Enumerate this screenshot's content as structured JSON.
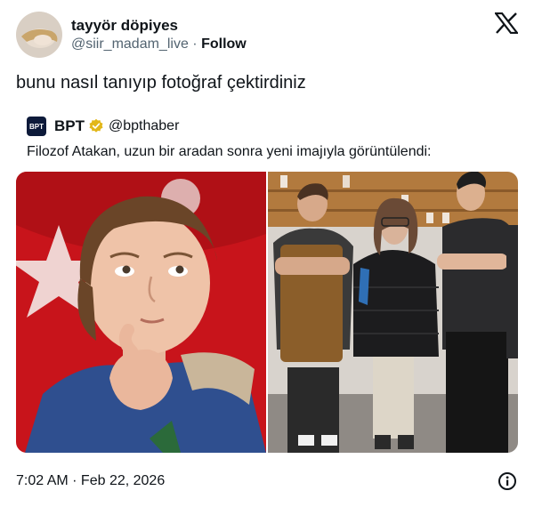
{
  "author": {
    "display_name": "tayyör döpiyes",
    "handle": "@siir_madam_live",
    "separator": "·",
    "follow_label": "Follow"
  },
  "tweet": {
    "text": "bunu nasıl tanıyıp fotoğraf çektirdiniz",
    "timestamp": "7:02 AM · Feb 22, 2026"
  },
  "quoted": {
    "avatar_text": "BPT",
    "name": "BPT",
    "handle": "@bpthaber",
    "text": "Filozof Atakan, uzun bir aradan sonra yeni imajıyla görüntülendi:"
  },
  "icons": {
    "brand": "x-logo-icon",
    "verified": "verified-badge-icon",
    "info": "info-icon"
  },
  "colors": {
    "text": "#0f1419",
    "secondary": "#536471",
    "verified_gold": "#e2b719",
    "flag_red": "#d81e1e"
  }
}
